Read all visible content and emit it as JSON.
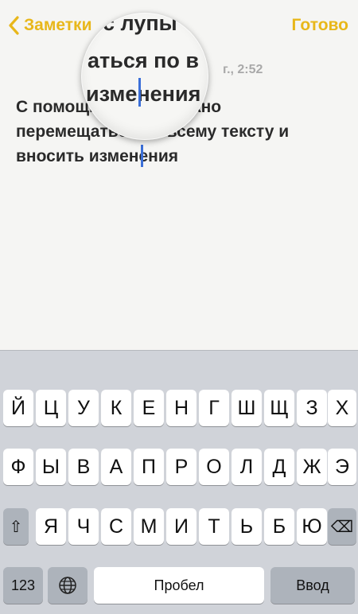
{
  "nav": {
    "back_label": "Заметки",
    "done_label": "Готово"
  },
  "note": {
    "date": "г., 2:52",
    "text": "С помощью лупы можно\nперемещаться по всему тексту и\nвносить изменения"
  },
  "magnifier": {
    "line1": "с лупы",
    "line2": "аться по в",
    "line3": "изменения"
  },
  "keyboard": {
    "row1": [
      "Й",
      "Ц",
      "У",
      "К",
      "Е",
      "Н",
      "Г",
      "Ш",
      "Щ",
      "З",
      "Х"
    ],
    "row2": [
      "Ф",
      "Ы",
      "В",
      "А",
      "П",
      "Р",
      "О",
      "Л",
      "Д",
      "Ж",
      "Э"
    ],
    "row3": [
      "Я",
      "Ч",
      "С",
      "М",
      "И",
      "Т",
      "Ь",
      "Б",
      "Ю"
    ],
    "shift": "⇧",
    "delete": "⌫",
    "numbers_label": "123",
    "globe": "🌐",
    "space_label": "Пробел",
    "return_label": "Ввод"
  },
  "colors": {
    "accent": "#e8b71a",
    "keyboard_bg": "#d0d3d9",
    "key": "#ffffff",
    "key_dark": "#adb3bb",
    "caret": "#3b6fd8"
  }
}
